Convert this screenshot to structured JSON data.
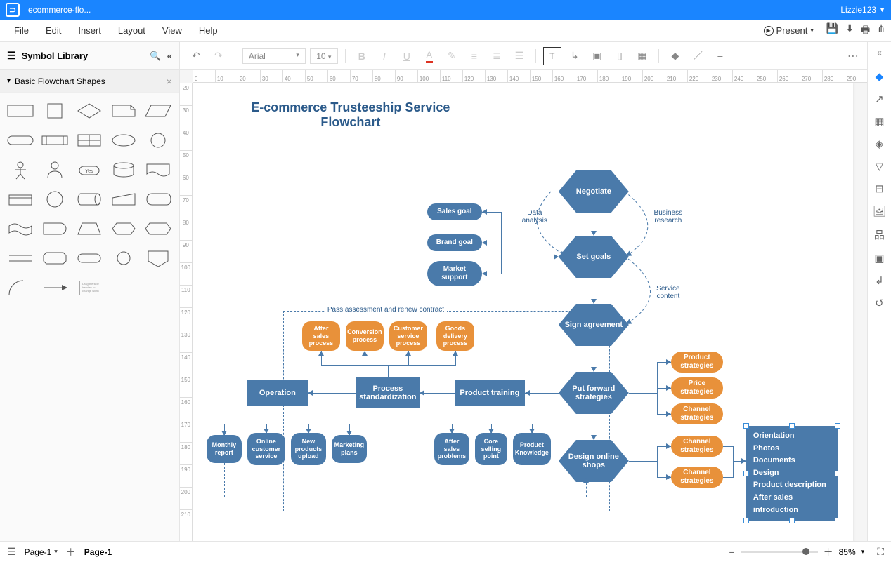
{
  "titlebar": {
    "filename": "ecommerce-flo...",
    "user": "Lizzie123"
  },
  "menubar": {
    "items": [
      "File",
      "Edit",
      "Insert",
      "Layout",
      "View",
      "Help"
    ],
    "present": "Present"
  },
  "sidebar": {
    "title": "Symbol Library",
    "group": "Basic Flowchart Shapes",
    "yes": "Yes",
    "note": "Drag the side handles to change the width of the text block."
  },
  "toolbar": {
    "font": "Arial",
    "size": "10"
  },
  "ruler_h": [
    "0",
    "10",
    "20",
    "30",
    "40",
    "50",
    "60",
    "70",
    "80",
    "90",
    "100",
    "110",
    "120",
    "130",
    "140",
    "150",
    "160",
    "170",
    "180",
    "190",
    "200",
    "210",
    "220",
    "230",
    "240",
    "250",
    "260",
    "270",
    "280",
    "290"
  ],
  "ruler_v": [
    "20",
    "30",
    "40",
    "50",
    "60",
    "70",
    "80",
    "90",
    "100",
    "110",
    "120",
    "130",
    "140",
    "150",
    "160",
    "170",
    "180",
    "190",
    "200",
    "210"
  ],
  "flowchart": {
    "title": "E-commerce Trusteeship Service Flowchart",
    "nodes": {
      "negotiate": "Negotiate",
      "set_goals": "Set goals",
      "sign_agreement": "Sign agreement",
      "put_forward": "Put forward strategies",
      "design_shops": "Design online shops",
      "sales_goal": "Sales goal",
      "brand_goal": "Brand goal",
      "market_support": "Market support",
      "operation": "Operation",
      "process_std": "Process standardization",
      "product_training": "Product training",
      "after_sales_process": "After sales process",
      "conversion_process": "Conversion process",
      "customer_service_process": "Customer service process",
      "goods_delivery_process": "Goods delivery process",
      "monthly_report": "Monthly report",
      "online_customer_service": "Online customer service",
      "new_products_upload": "New products upload",
      "marketing_plans": "Marketing plans",
      "after_sales_problems": "After sales problems",
      "core_selling_point": "Core selling point",
      "product_knowledge": "Product Knowledge",
      "product_strategies": "Product strategies",
      "price_strategies": "Price strategies",
      "channel_strategies": "Channel strategies",
      "channel_strategies2": "Channel strategies",
      "channel_strategies3": "Channel strategies"
    },
    "labels": {
      "data_analysis": "Data analysis",
      "business_research": "Business research",
      "service_content": "Service content",
      "pass_assessment": "Pass assessment and renew contract"
    },
    "list_box": [
      "Orientation",
      "Photos",
      "Documents",
      "Design",
      "Product description",
      "After sales introduction"
    ]
  },
  "bottombar": {
    "tab1": "Page-1",
    "tab_active": "Page-1",
    "zoom": "85%"
  }
}
